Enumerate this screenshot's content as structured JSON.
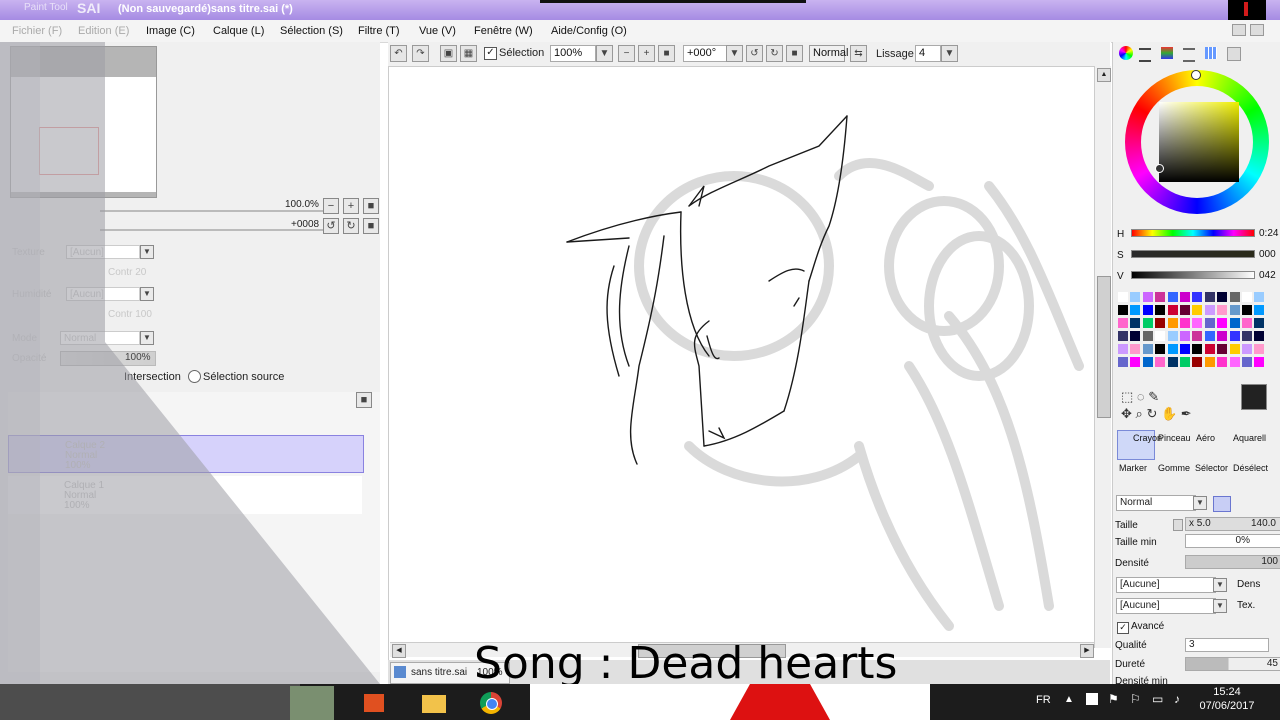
{
  "window": {
    "app_label": "Paint Tool",
    "app_short": "SAI",
    "title": "(Non sauvegardé)sans titre.sai (*)"
  },
  "menu": [
    "Fichier (F)",
    "Edition (E)",
    "Image (C)",
    "Calque (L)",
    "Sélection (S)",
    "Filtre (T)",
    "Vue (V)",
    "Fenêtre (W)",
    "Aide/Config (O)"
  ],
  "left_panel": {
    "zoom_value": "100.0%",
    "angle_value": "+0008",
    "texture_label": "Texture",
    "texture_value": "[Aucun]",
    "texture_contr": "Contr 20",
    "humidity_label": "Humidité",
    "humidity_value": "[Aucun]",
    "humidity_contr": "Contr 100",
    "mode_label": "Mode",
    "mode_value": "Normal",
    "opacity_label": "Opacité",
    "opacity_value": "100%",
    "intersection": "Intersection",
    "selection_source": "Sélection source",
    "layers": [
      {
        "name": "Calque 2",
        "mode": "Normal",
        "opacity": "100%"
      },
      {
        "name": "Calque 1",
        "mode": "Normal",
        "opacity": "100%"
      }
    ]
  },
  "toolbar": {
    "selection_label": "Sélection",
    "zoom": "100%",
    "rotation": "+000°",
    "blend": "Normal",
    "smoothing_label": "Lissage",
    "smoothing": "4"
  },
  "canvas_tab": {
    "name": "sans titre.sai",
    "zoom": "100%"
  },
  "caption": "Song : Dead hearts",
  "right_panel": {
    "h_label": "H",
    "h_value": "0:24",
    "s_label": "S",
    "s_value": "000",
    "v_label": "V",
    "v_value": "042",
    "tools_row1": [
      "Crayon",
      "Pinceau",
      "Aéro",
      "Aquarell"
    ],
    "tools_row2": [
      "Marker",
      "Gomme",
      "Sélector",
      "Désélect"
    ],
    "blend_mode": "Normal",
    "size_label": "Taille",
    "size_mult": "x 5.0",
    "size_value": "140.0",
    "min_size_label": "Taille min",
    "min_size_value": "0%",
    "density_label": "Densité",
    "density_value": "100",
    "texture1": "[Aucune]",
    "texture1_side": "Dens",
    "texture2": "[Aucune]",
    "texture2_side": "Tex.",
    "advanced_label": "Avancé",
    "quality_label": "Qualité",
    "quality_value": "3",
    "hardness_label": "Dureté",
    "hardness_value": "45",
    "density_min_label": "Densité min"
  },
  "colors": {
    "titlebar": "#a58be3",
    "layer_selected": "#d6d2fb",
    "taskbar": "#1c1c1c"
  },
  "taskbar": {
    "language": "FR",
    "time": "15:24",
    "date": "07/06/2017"
  }
}
